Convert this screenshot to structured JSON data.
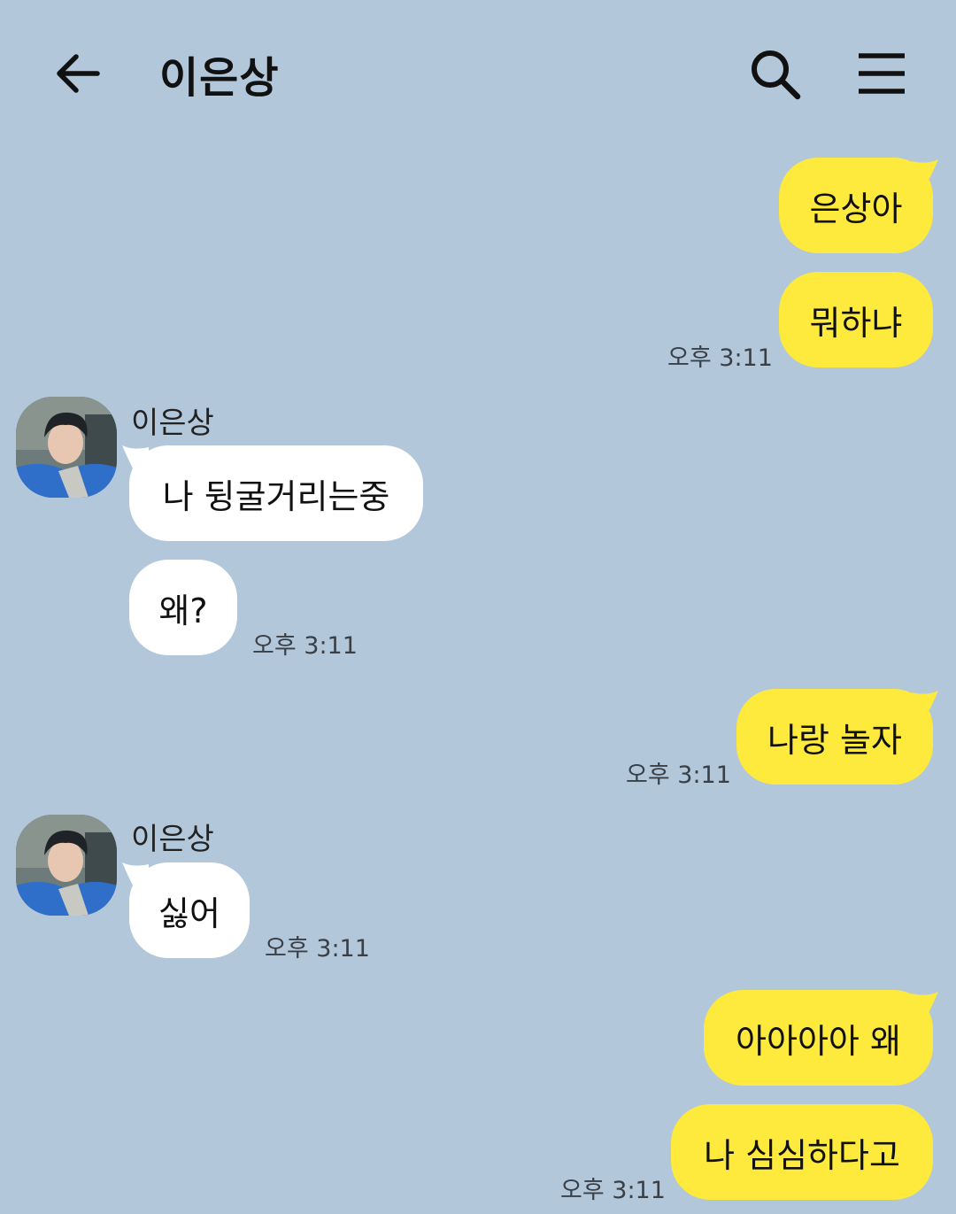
{
  "header": {
    "title": "이은상",
    "back_icon": "arrow-left-icon",
    "search_icon": "search-icon",
    "menu_icon": "hamburger-menu-icon"
  },
  "colors": {
    "background": "#b2c7da",
    "my_bubble": "#fee93d",
    "their_bubble": "#ffffff"
  },
  "messages": [
    {
      "from": "me",
      "text": "은상아"
    },
    {
      "from": "me",
      "text": "뭐하냐",
      "time": "오후 3:11"
    },
    {
      "from": "them",
      "sender": "이은상",
      "text": "나 뒹굴거리는중"
    },
    {
      "from": "them",
      "text": "왜?",
      "time": "오후 3:11"
    },
    {
      "from": "me",
      "text": "나랑 놀자",
      "time": "오후 3:11"
    },
    {
      "from": "them",
      "sender": "이은상",
      "text": "싫어",
      "time": "오후 3:11"
    },
    {
      "from": "me",
      "text": "아아아아 왜"
    },
    {
      "from": "me",
      "text": "나 심심하다고",
      "time": "오후 3:11"
    }
  ]
}
